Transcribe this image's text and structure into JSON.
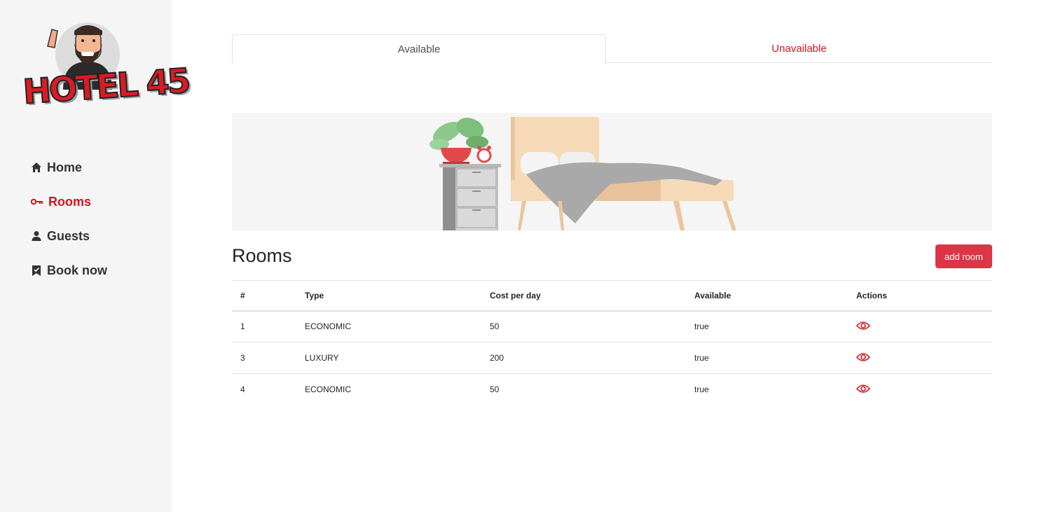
{
  "brand": {
    "logo_text": "HOTEL 45",
    "accent": "#d0161e"
  },
  "sidebar": {
    "items": [
      {
        "label": "Home",
        "icon": "home-icon",
        "active": false
      },
      {
        "label": "Rooms",
        "icon": "key-icon",
        "active": true
      },
      {
        "label": "Guests",
        "icon": "user-icon",
        "active": false
      },
      {
        "label": "Book now",
        "icon": "bookmark-icon",
        "active": false
      }
    ]
  },
  "tabs": [
    {
      "label": "Available",
      "active": true
    },
    {
      "label": "Unavailable",
      "active": false
    }
  ],
  "main": {
    "title": "Rooms",
    "add_button_label": "add room",
    "add_button_color": "#dc3545"
  },
  "table": {
    "headers": [
      "#",
      "Type",
      "Cost per day",
      "Available",
      "Actions"
    ],
    "rows": [
      {
        "id": "1",
        "type": "ECONOMIC",
        "cost": "50",
        "available": "true",
        "action_icon": "eye-icon"
      },
      {
        "id": "3",
        "type": "LUXURY",
        "cost": "200",
        "available": "true",
        "action_icon": "eye-icon"
      },
      {
        "id": "4",
        "type": "ECONOMIC",
        "cost": "50",
        "available": "true",
        "action_icon": "eye-icon"
      }
    ]
  }
}
